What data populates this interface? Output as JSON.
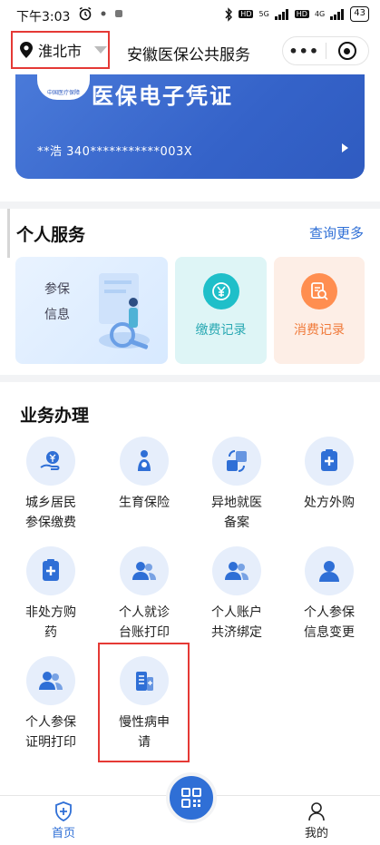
{
  "status_bar": {
    "time": "下午3:03",
    "battery": "43",
    "network_1": "5G",
    "network_2": "4G",
    "hd": "HD"
  },
  "header": {
    "city": "淮北市",
    "title": "安徽医保公共服务",
    "more_label": "•••"
  },
  "card": {
    "title": "医保电子凭证",
    "id_masked": "**浩 340***********003X",
    "logo_text": "中国医疗保障"
  },
  "personal": {
    "title": "个人服务",
    "view_more": "查询更多",
    "tiles": [
      {
        "label": "参保\n信息"
      },
      {
        "label": "缴费记录",
        "icon": "yuan-icon"
      },
      {
        "label": "消费记录",
        "icon": "search-document-icon"
      }
    ]
  },
  "business": {
    "title": "业务办理",
    "items": [
      {
        "label": "城乡居民\n参保缴费",
        "icon": "hand-yuan-icon"
      },
      {
        "label": "生育保险",
        "icon": "mother-baby-icon"
      },
      {
        "label": "异地就医\n备案",
        "icon": "transfer-icon"
      },
      {
        "label": "处方外购",
        "icon": "prescription-icon"
      },
      {
        "label": "非处方购\n药",
        "icon": "clipboard-plus-icon"
      },
      {
        "label": "个人就诊\n台账打印",
        "icon": "users-icon"
      },
      {
        "label": "个人账户\n共济绑定",
        "icon": "users-icon"
      },
      {
        "label": "个人参保\n信息变更",
        "icon": "user-icon"
      },
      {
        "label": "个人参保\n证明打印",
        "icon": "users-icon"
      },
      {
        "label": "慢性病申\n请",
        "icon": "hospital-building-icon"
      }
    ]
  },
  "tabbar": {
    "home": "首页",
    "mine": "我的"
  },
  "colors": {
    "accent": "#2f6fd6",
    "highlight": "#e53935",
    "card_blue": "#3563c9"
  }
}
